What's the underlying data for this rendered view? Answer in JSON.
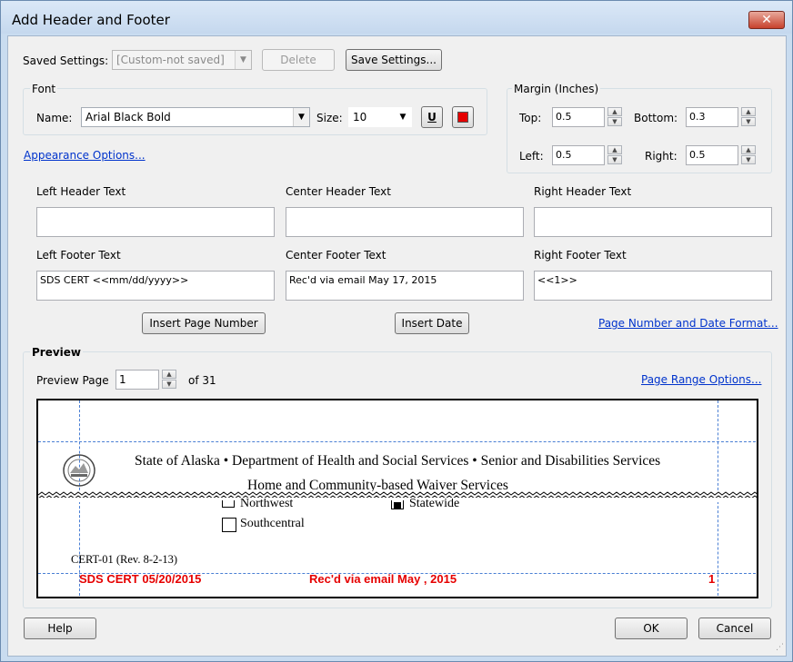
{
  "window": {
    "title": "Add Header and Footer",
    "close_glyph": "✕"
  },
  "saved_settings": {
    "label": "Saved Settings:",
    "value": "[Custom-not saved]",
    "delete_label": "Delete",
    "save_label": "Save Settings..."
  },
  "font": {
    "group_label": "Font",
    "name_label": "Name:",
    "name_value": "Arial Black Bold",
    "size_label": "Size:",
    "size_value": "10",
    "underline_label": "U",
    "color": "#e60000"
  },
  "margin": {
    "group_label": "Margin (Inches)",
    "top_label": "Top:",
    "top_value": "0.5",
    "bottom_label": "Bottom:",
    "bottom_value": "0.3",
    "left_label": "Left:",
    "left_value": "0.5",
    "right_label": "Right:",
    "right_value": "0.5"
  },
  "appearance_link": "Appearance Options...",
  "header": {
    "left_label": "Left Header Text",
    "left_value": "",
    "center_label": "Center Header Text",
    "center_value": "",
    "right_label": "Right Header Text",
    "right_value": ""
  },
  "footer": {
    "left_label": "Left Footer Text",
    "left_value": "SDS CERT <<mm/dd/yyyy>>",
    "center_label": "Center Footer Text",
    "center_value": "Rec'd via email  May 17, 2015",
    "right_label": "Right Footer Text",
    "right_value": "<<1>>"
  },
  "actions": {
    "insert_page_number": "Insert Page Number",
    "insert_date": "Insert Date",
    "page_number_format_link": "Page Number and Date Format..."
  },
  "preview": {
    "group_label": "Preview",
    "page_label": "Preview Page",
    "page_value": "1",
    "of_text": "of 31",
    "page_range_link": "Page Range Options...",
    "doc_line1": "State of Alaska • Department of Health and Social Services • Senior and Disabilities Services",
    "doc_line2": "Home and Community-based Waiver Services",
    "region_northwest": "Northwest",
    "region_statewide": "Statewide",
    "region_southcentral": "Southcentral",
    "form_id": "CERT-01 (Rev. 8-2-13)",
    "footer_left": "SDS CERT 05/20/2015",
    "footer_center": "Rec'd via email  May , 2015",
    "footer_right": "1"
  },
  "bottom": {
    "help_label": "Help",
    "ok_label": "OK",
    "cancel_label": "Cancel"
  }
}
